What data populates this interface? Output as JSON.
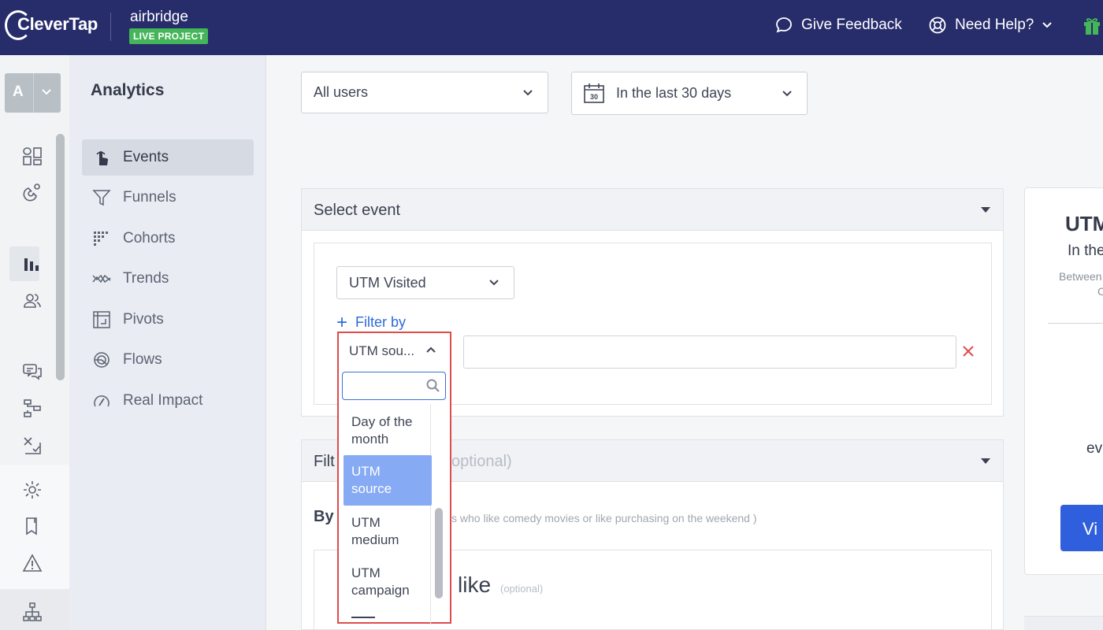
{
  "header": {
    "brand": "CleverTap",
    "project_name": "airbridge",
    "project_badge": "LIVE PROJECT",
    "feedback": "Give Feedback",
    "help": "Need Help?"
  },
  "account": {
    "letter": "A"
  },
  "subnav": {
    "title": "Analytics",
    "items": [
      {
        "label": "Events"
      },
      {
        "label": "Funnels"
      },
      {
        "label": "Cohorts"
      },
      {
        "label": "Trends"
      },
      {
        "label": "Pivots"
      },
      {
        "label": "Flows"
      },
      {
        "label": "Real Impact"
      }
    ]
  },
  "filters": {
    "users": "All users",
    "date_range": "In the last 30 days"
  },
  "select_event": {
    "title": "Select event",
    "event": "UTM Visited",
    "filter_by": "Filter by",
    "property_selected": "UTM sou...",
    "value_placeholder": ""
  },
  "dropdown": {
    "search_placeholder": "",
    "options": [
      "Day of the month",
      "UTM source",
      "UTM medium",
      "UTM campaign"
    ],
    "highlighted": "UTM source"
  },
  "filter_people": {
    "title_start": "Filt",
    "title_end": "optional)",
    "by_label": "By",
    "hint": "s who like comedy movies or like purchasing on the weekend )",
    "like_word": "like",
    "optional": "(optional)"
  },
  "right_card": {
    "title": "UTM",
    "subtitle": "In the",
    "between": "Between",
    "small_c": "C",
    "ev": "ev",
    "button": "Vi"
  },
  "colors": {
    "topbar": "#272c6b",
    "accent_blue": "#2e6bd9",
    "highlight": "#86aaf3",
    "danger": "#e04b4b",
    "live_green": "#45b559"
  }
}
